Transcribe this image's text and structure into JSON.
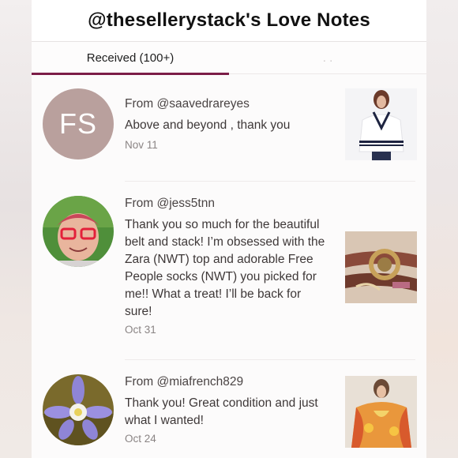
{
  "header": {
    "title": "@thesellerystack's Love Notes"
  },
  "tabs": {
    "received_label": "Received (100+)",
    "given_label": ". ."
  },
  "notes": [
    {
      "from": "From @saavedrareyes",
      "avatar_initials": "FS",
      "message": "Above and beyond , thank you",
      "date": "Nov 11"
    },
    {
      "from": "From @jess5tnn",
      "message": "Thank you so much for the beautiful belt and stack! I’m obsessed with the Zara (NWT) top and adorable Free People socks (NWT) you picked for me!! What a treat! I’ll be back for sure!",
      "date": "Oct 31"
    },
    {
      "from": "From @miafrench829",
      "message": "Thank you! Great condition and just what I wanted!",
      "date": "Oct 24"
    }
  ],
  "colors": {
    "accent": "#7b1d47",
    "avatar_initials_bg": "#b9a09d"
  }
}
